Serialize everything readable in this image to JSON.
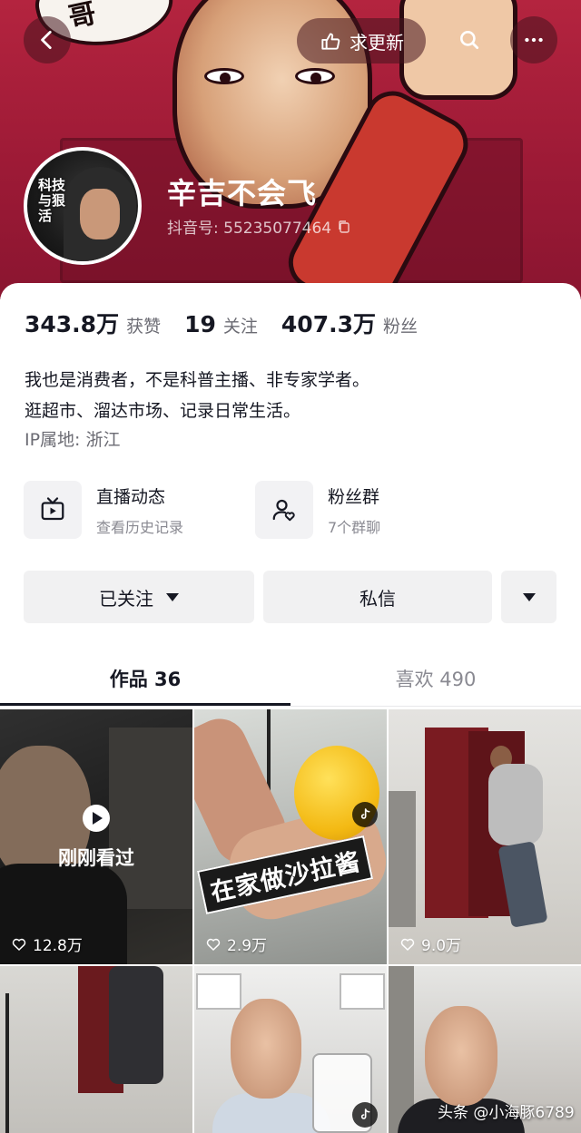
{
  "header": {
    "request_update_label": "求更新",
    "banner_shout": "哥"
  },
  "profile": {
    "name": "辛吉不会飞",
    "douyin_id": "抖音号: 55235077464",
    "avatar_badge": "科技与狠活"
  },
  "stats": [
    {
      "value": "343.8万",
      "label": "获赞"
    },
    {
      "value": "19",
      "label": "关注"
    },
    {
      "value": "407.3万",
      "label": "粉丝"
    }
  ],
  "bio": {
    "line1": "我也是消费者，不是科普主播、非专家学者。",
    "line2": "逛超市、溜达市场、记录日常生活。",
    "ip": "IP属地: 浙江"
  },
  "features": [
    {
      "title": "直播动态",
      "subtitle": "查看历史记录",
      "icon": "tv-icon"
    },
    {
      "title": "粉丝群",
      "subtitle": "7个群聊",
      "icon": "user-heart-icon"
    }
  ],
  "actions": {
    "following_label": "已关注",
    "message_label": "私信"
  },
  "tabs": [
    {
      "label": "作品 36",
      "active": true
    },
    {
      "label": "喜欢 490",
      "active": false
    }
  ],
  "videos": [
    {
      "likes": "12.8万",
      "overlay": "刚刚看过"
    },
    {
      "likes": "2.9万",
      "caption": "在家做沙拉酱"
    },
    {
      "likes": "9.0万"
    },
    {},
    {},
    {}
  ],
  "watermark": "头条 @小海豚6789",
  "colors": {
    "banner": "#9d1a36",
    "text_primary": "#161823",
    "text_secondary": "#6b6b73",
    "button_bg": "#f1f1f2"
  }
}
